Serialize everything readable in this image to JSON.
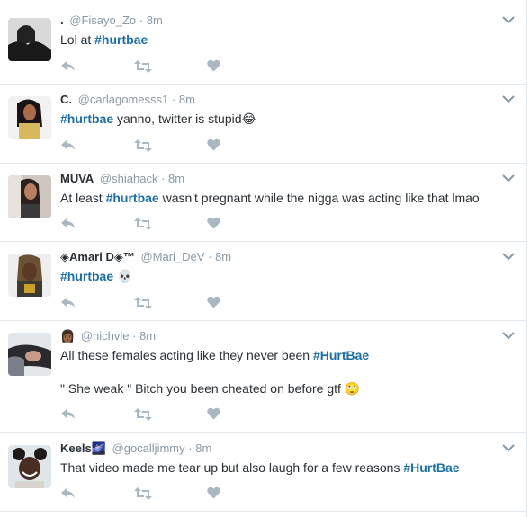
{
  "tweets": [
    {
      "name": ".",
      "handle": "@Fisayo_Zo",
      "sep": "·",
      "time": "8m",
      "badge": "",
      "lines": [
        [
          {
            "t": "Lol at "
          },
          {
            "t": "#hurtbae",
            "h": true
          }
        ]
      ]
    },
    {
      "name": "C.",
      "handle": "@carlagomesss1",
      "sep": "·",
      "time": "8m",
      "badge": "",
      "lines": [
        [
          {
            "t": "#hurtbae",
            "h": true
          },
          {
            "t": " yanno, twitter is stupid😂"
          }
        ]
      ]
    },
    {
      "name": "MUVA",
      "handle": "@shiahack",
      "sep": "·",
      "time": "8m",
      "badge": "",
      "lines": [
        [
          {
            "t": "At least "
          },
          {
            "t": "#hurtbae",
            "h": true
          },
          {
            "t": " wasn't pregnant while the nigga was acting like that lmao"
          }
        ]
      ]
    },
    {
      "name": "◈Amari D◈™",
      "handle": "@Mari_DeV",
      "sep": "·",
      "time": "8m",
      "badge": "",
      "lines": [
        [
          {
            "t": "#hurtbae",
            "h": true
          },
          {
            "t": " 💀"
          }
        ]
      ]
    },
    {
      "name": "",
      "handle": "@nichvle",
      "sep": "·",
      "time": "8m",
      "badge": "👩🏾",
      "lines": [
        [
          {
            "t": "All these females acting like they never been "
          },
          {
            "t": "#HurtBae",
            "h": true
          }
        ],
        [
          {
            "t": "\" She weak \" Bitch you been cheated on before gtf 🙄"
          }
        ]
      ]
    },
    {
      "name": "Keels",
      "handle": "@gocalljimmy",
      "sep": "·",
      "time": "8m",
      "badge": "🌌",
      "lines": [
        [
          {
            "t": "That video made me tear up but also laugh for a few reasons "
          },
          {
            "t": "#HurtBae",
            "h": true
          }
        ]
      ]
    }
  ],
  "icons": {
    "reply": "reply-icon",
    "retweet": "retweet-icon",
    "like": "heart-icon",
    "caret": "chevron-down-icon"
  },
  "colors": {
    "hashtag": "#1b6fa8",
    "action_icon": "#aab8c2",
    "meta": "#8899a6",
    "divider": "#e1e8ed"
  }
}
